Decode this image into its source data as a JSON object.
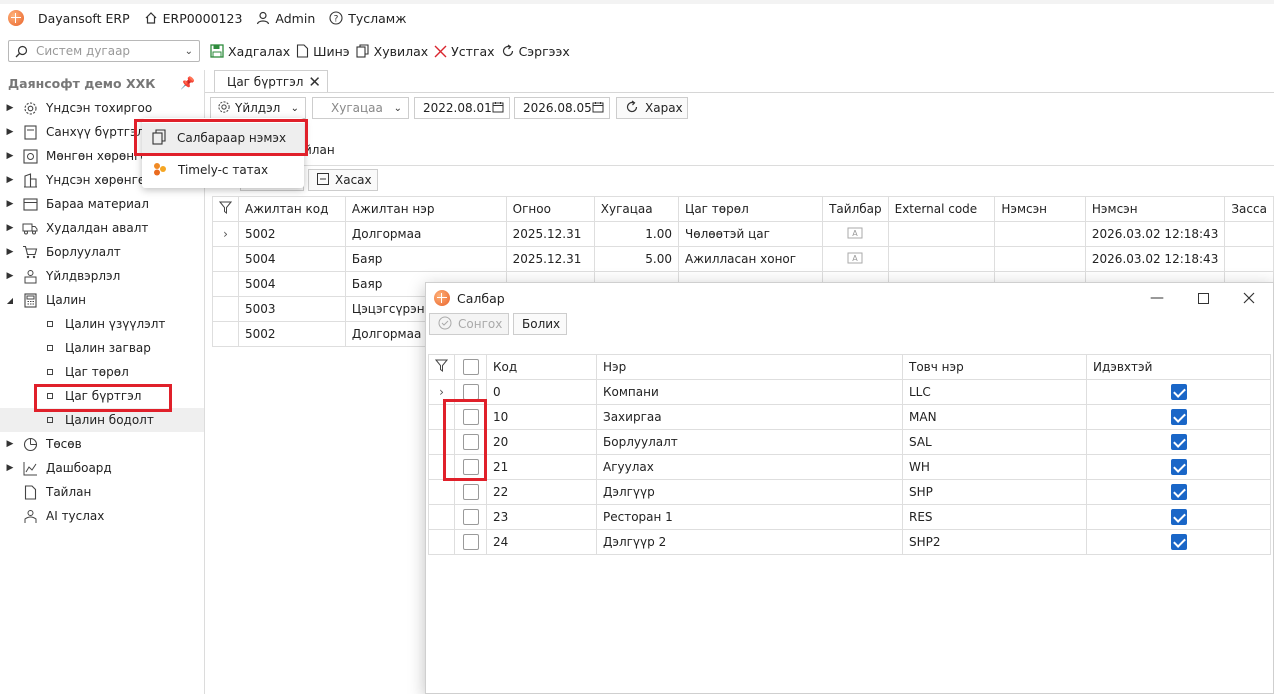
{
  "app": {
    "name": "Dayansoft ERP",
    "code": "ERP0000123",
    "user": "Admin",
    "help": "Тусламж"
  },
  "toolbar": {
    "search_placeholder": "Систем дугаар",
    "save": "Хадгалах",
    "new": "Шинэ",
    "copy": "Хувилах",
    "delete": "Устгах",
    "refresh": "Сэргээх"
  },
  "sidebar": {
    "company": "Даянсофт демо ХХК",
    "items": [
      {
        "label": "Үндсэн тохиргоо",
        "icon": "gear-icon"
      },
      {
        "label": "Санхүү бүртгэл",
        "icon": "ledger-icon"
      },
      {
        "label": "Мөнгөн хөрөнгө",
        "icon": "cash-icon"
      },
      {
        "label": "Үндсэн хөрөнгө",
        "icon": "building-icon"
      },
      {
        "label": "Бараа материал",
        "icon": "box-icon"
      },
      {
        "label": "Худалдан авалт",
        "icon": "truck-icon"
      },
      {
        "label": "Борлуулалт",
        "icon": "cart-icon"
      },
      {
        "label": "Үйлдвэрлэл",
        "icon": "factory-icon"
      },
      {
        "label": "Цалин",
        "icon": "calculator-icon"
      }
    ],
    "sub_items": [
      {
        "label": "Цалин үзүүлэлт"
      },
      {
        "label": "Цалин загвар"
      },
      {
        "label": "Цаг төрөл"
      },
      {
        "label": "Цаг бүртгэл"
      },
      {
        "label": "Цалин бодолт"
      }
    ],
    "items_after": [
      {
        "label": "Төсөв",
        "icon": "pie-icon"
      },
      {
        "label": "Дашбоард",
        "icon": "chart-icon"
      },
      {
        "label": "Тайлан",
        "icon": "report-icon"
      },
      {
        "label": "AI туслах",
        "icon": "robot-icon"
      }
    ]
  },
  "tab": {
    "label": "Цаг бүртгэл"
  },
  "filters": {
    "action": "Үйлдэл",
    "period": "Хугацаа",
    "date_from": "2022.08.01",
    "date_to": "2026.08.05",
    "view": "Харах",
    "report_fragment": "йлан",
    "remove": "Хасах"
  },
  "context_menu": {
    "add_by_branch": "Салбараар нэмэх",
    "import_timely": "Timely-с татах"
  },
  "grid": {
    "columns": [
      "Ажилтан код",
      "Ажилтан нэр",
      "Огноо",
      "Хугацаа",
      "Цаг төрөл",
      "Тайлбар",
      "External code",
      "Нэмсэн",
      "Нэмсэн",
      "Засса"
    ],
    "rows": [
      {
        "code": "5002",
        "name": "Долгормаа",
        "date": "2025.12.31",
        "hours": "1.00",
        "type": "Чөлөөтэй цаг",
        "added": "2026.03.02 12:18:43"
      },
      {
        "code": "5004",
        "name": "Баяр",
        "date": "2025.12.31",
        "hours": "5.00",
        "type": "Ажилласан хоног",
        "added": "2026.03.02 12:18:43"
      },
      {
        "code": "5004",
        "name": "Баяр",
        "date": "",
        "hours": "",
        "type": "",
        "added": ""
      },
      {
        "code": "5003",
        "name": "Цэцэгсүрэн",
        "date": "",
        "hours": "",
        "type": "",
        "added": ""
      },
      {
        "code": "5002",
        "name": "Долгормаа",
        "date": "",
        "hours": "",
        "type": "",
        "added": ""
      }
    ]
  },
  "dialog": {
    "title": "Салбар",
    "select": "Сонгох",
    "cancel": "Болих",
    "columns": [
      "Код",
      "Нэр",
      "Товч нэр",
      "Идэвхтэй"
    ],
    "rows": [
      {
        "code": "0",
        "name": "Компани",
        "short": "LLC",
        "active": true
      },
      {
        "code": "10",
        "name": "Захиргаа",
        "short": "MAN",
        "active": true
      },
      {
        "code": "20",
        "name": "Борлуулалт",
        "short": "SAL",
        "active": true
      },
      {
        "code": "21",
        "name": "Агуулах",
        "short": "WH",
        "active": true
      },
      {
        "code": "22",
        "name": "Дэлгүүр",
        "short": "SHP",
        "active": true
      },
      {
        "code": "23",
        "name": "Ресторан 1",
        "short": "RES",
        "active": true
      },
      {
        "code": "24",
        "name": "Дэлгүүр 2",
        "short": "SHP2",
        "active": true
      }
    ]
  },
  "colors": {
    "accent": "#1a66c7",
    "highlight": "#e0202a",
    "brand": "#e8622a"
  }
}
